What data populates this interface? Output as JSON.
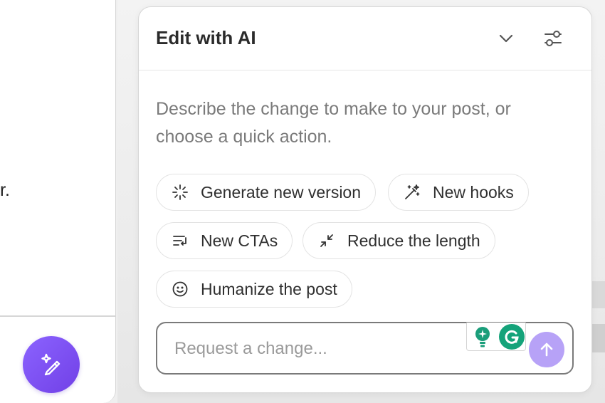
{
  "editor": {
    "text_fragment": "r.",
    "magic_button_icon": "magic-pencil-icon"
  },
  "panel": {
    "title": "Edit with AI",
    "collapse_icon": "chevron-down-icon",
    "settings_icon": "sliders-icon",
    "intro": "Describe the change to make to your post, or choose a quick action.",
    "quick_actions": [
      {
        "label": "Generate new version",
        "icon": "loader-sparkle-icon"
      },
      {
        "label": "New hooks",
        "icon": "magic-wand-icon"
      },
      {
        "label": "New CTAs",
        "icon": "list-return-icon"
      },
      {
        "label": "Reduce the length",
        "icon": "shrink-arrows-icon"
      },
      {
        "label": "Humanize the post",
        "icon": "smiley-icon"
      }
    ],
    "request": {
      "placeholder": "Request a change...",
      "value": "",
      "send_icon": "arrow-up-icon"
    },
    "extensions": {
      "bulb_icon": "lightbulb-icon",
      "grammarly_icon": "grammarly-icon"
    }
  },
  "colors": {
    "accent": "#7b4ff0",
    "send_button": "#b7a2f7",
    "grammarly": "#15a37a",
    "bulb": "#1a9e7a"
  }
}
